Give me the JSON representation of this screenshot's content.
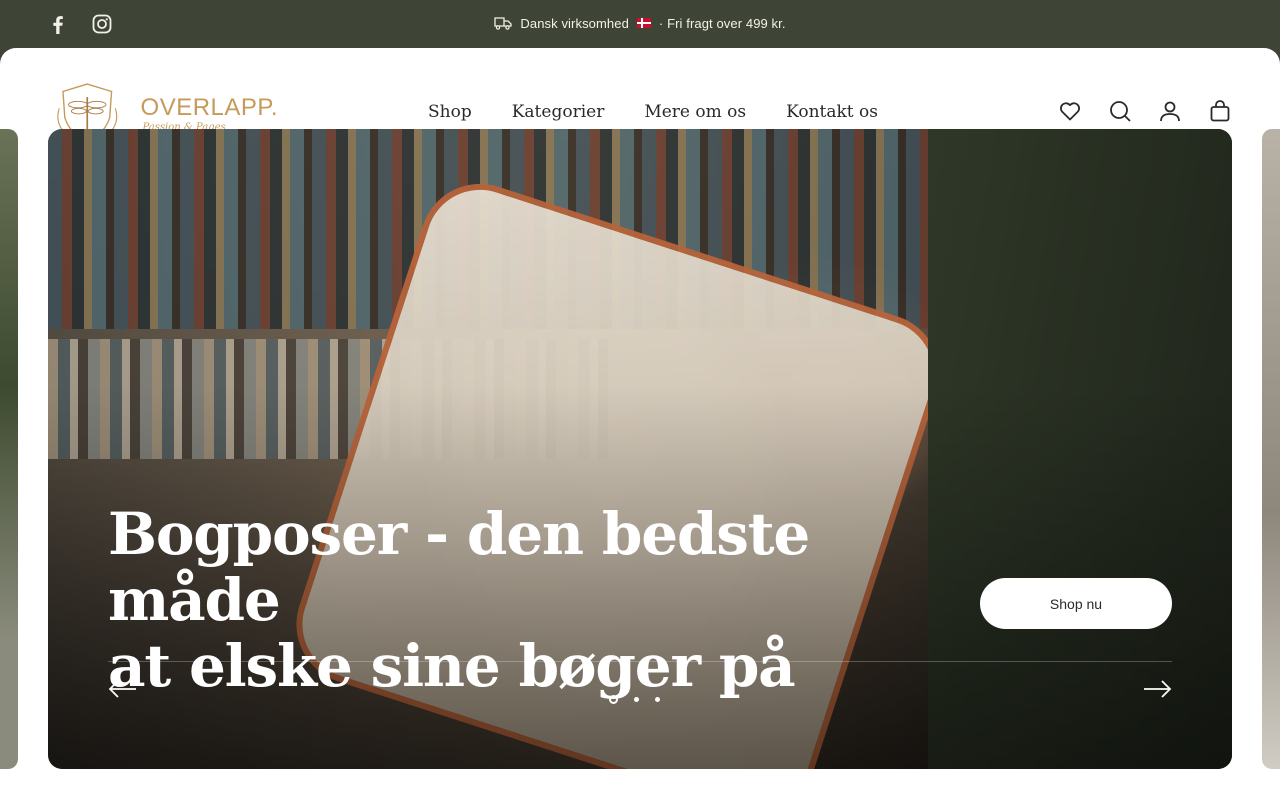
{
  "announcement": {
    "text_before": "Dansk virksomhed",
    "text_after": "· Fri fragt over 499 kr."
  },
  "social": {
    "facebook": "facebook-icon",
    "instagram": "instagram-icon"
  },
  "brand": {
    "name": "OVERLAPP.",
    "tagline": "Passion & Pages",
    "accent": "#c69a5a"
  },
  "nav": {
    "items": [
      {
        "label": "Shop"
      },
      {
        "label": "Kategorier"
      },
      {
        "label": "Mere om os"
      },
      {
        "label": "Kontakt os"
      }
    ]
  },
  "header_icons": [
    "heart-icon",
    "search-icon",
    "account-icon",
    "cart-icon"
  ],
  "hero": {
    "title_line1": "Bogposer - den bedste måde",
    "title_line2": "at elske sine bøger på",
    "cta_label": "Shop nu",
    "slides_total": 3,
    "active_slide": 1
  },
  "colors": {
    "topbar": "#3e4436",
    "text": "#2a2a2a"
  }
}
